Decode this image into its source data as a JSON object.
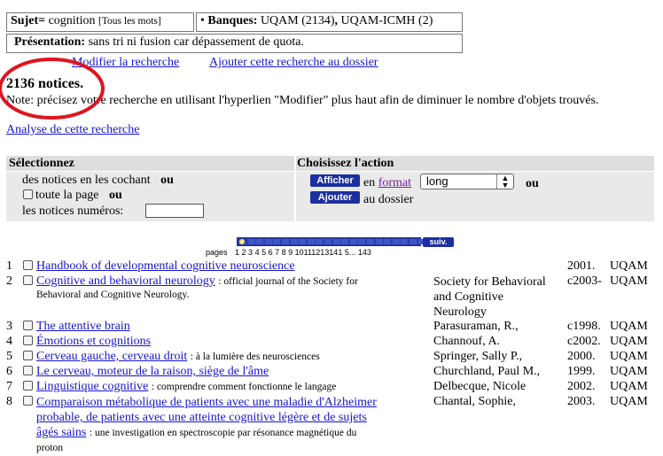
{
  "query": {
    "subject_label": "Sujet=",
    "subject_value": "cognition",
    "subject_scope": "[Tous les mots]",
    "bullet": "•",
    "banks_label": "Banques:",
    "bank1": "UQAM (2134)",
    "sep": ",",
    "bank2": "UQAM-ICMH (2)",
    "presentation_label": "Présentation:",
    "presentation_value": "sans tri ni fusion car dépassement de quota."
  },
  "links": {
    "modify": "Modifier la recherche",
    "add_to_folder": "Ajouter cette recherche au dossier",
    "analysis": "Analyse de cette recherche"
  },
  "result_count": "2136 notices.",
  "note": "Note: précisez votre recherche en utilisant l'hyperlien \"Modifier\" plus haut afin de diminuer le nombre d'objets trouvés.",
  "selection": {
    "header": "Sélectionnez",
    "line1": "des notices en les cochant",
    "or": "ou",
    "line2": "toute la page",
    "line3": "les notices numéros:"
  },
  "action": {
    "header": "Choisissez l'action",
    "show_button": "Afficher",
    "in_text": "en",
    "format_link": "format",
    "format_value": "long",
    "or": "ou",
    "add_button": "Ajouter",
    "folder_text": "au dossier"
  },
  "pagination": {
    "pages_label": "pages",
    "numbers": "1 2 3 4 5 6 7 8 9 10111213141 5... 143",
    "next_button": "suiv."
  },
  "results": [
    {
      "num": "1",
      "title": "Handbook of developmental cognitive neuroscience",
      "subtitle": "",
      "author": "",
      "date": "2001.",
      "bank": "UQAM"
    },
    {
      "num": "2",
      "title": "Cognitive and behavioral neurology",
      "subtitle": ": official journal of the Society for",
      "subtitle2": "Behavioral and Cognitive Neurology.",
      "author": "Society for Behavioral",
      "author2": "and Cognitive",
      "author3": "Neurology",
      "date": "c2003-",
      "bank": "UQAM"
    },
    {
      "num": "3",
      "title": "The attentive brain",
      "subtitle": "",
      "author": "Parasuraman, R.,",
      "date": "c1998.",
      "bank": "UQAM"
    },
    {
      "num": "4",
      "title": "Émotions et cognitions",
      "subtitle": "",
      "author": "Channouf, A.",
      "date": "c2002.",
      "bank": "UQAM"
    },
    {
      "num": "5",
      "title": "Cerveau gauche, cerveau droit",
      "subtitle": ": à la lumière des neurosciences",
      "author": "Springer, Sally P.,",
      "date": "2000.",
      "bank": "UQAM"
    },
    {
      "num": "6",
      "title": "Le cerveau, moteur de la raison, siège de l'âme",
      "subtitle": "",
      "author": "Churchland, Paul M.,",
      "date": "1999.",
      "bank": "UQAM"
    },
    {
      "num": "7",
      "title": "Linguistique cognitive",
      "subtitle": ": comprendre comment fonctionne le langage",
      "author": "Delbecque, Nicole",
      "date": "2002.",
      "bank": "UQAM"
    },
    {
      "num": "8",
      "title": "Comparaison métabolique de patients avec une maladie d'Alzheimer",
      "title2": "probable, de patients avec une atteinte cognitive légère et de sujets",
      "title3": "âgés sains",
      "subtitle": ": une investigation en spectroscopie par résonance magnétique du",
      "subtitle2": "proton",
      "author": "Chantal, Sophie,",
      "date": "2003.",
      "bank": "UQAM"
    }
  ],
  "colors": {
    "link": "#1515cc",
    "button": "#1b2fa0",
    "annotation": "#e0141e"
  }
}
